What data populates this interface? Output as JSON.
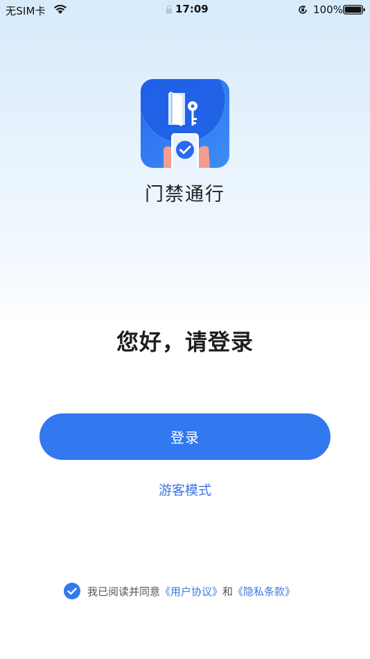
{
  "status_bar": {
    "carrier": "无SIM卡",
    "time": "17:09",
    "battery": "100%",
    "icons": [
      "wifi-icon",
      "lock-icon",
      "rotation-lock-icon",
      "battery-icon"
    ]
  },
  "app": {
    "name": "门禁通行",
    "logo_icon": "door-key-phone-icon"
  },
  "greeting": "您好，请登录",
  "login_button": "登录",
  "guest_mode": "游客模式",
  "agreement": {
    "checked": true,
    "prefix": "我已阅读并同意",
    "user_agreement": "《用户协议》",
    "conjunction": "和",
    "privacy_policy": "《隐私条款》"
  },
  "colors": {
    "accent": "#3278ef",
    "link": "#3a78e0"
  }
}
